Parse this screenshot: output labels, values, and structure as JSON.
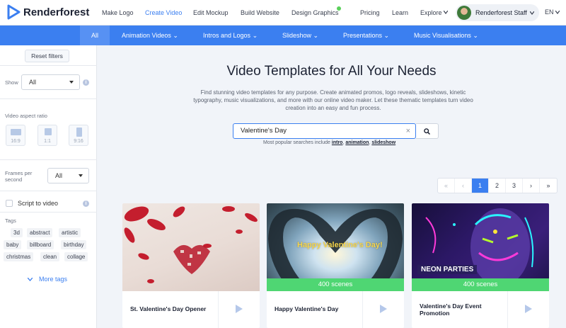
{
  "brand": {
    "name": "Renderforest",
    "accent": "#3b7ff0"
  },
  "topnav": {
    "items": [
      "Make Logo",
      "Create Video",
      "Edit Mockup",
      "Build Website",
      "Design Graphics",
      "Pricing",
      "Learn",
      "Explore"
    ],
    "active": "Create Video",
    "user": "Renderforest Staff",
    "lang": "EN"
  },
  "categories": [
    "All",
    "Animation Videos",
    "Intros and Logos",
    "Slideshow",
    "Presentations",
    "Music Visualisations"
  ],
  "sidebar": {
    "reset": "Reset filters",
    "show_label": "Show",
    "show_value": "All",
    "aspect_label": "Video aspect ratio",
    "ratios": [
      "16:9",
      "1:1",
      "9:16"
    ],
    "fps_label_line1": "Frames per",
    "fps_label_line2": "second",
    "fps_value": "All",
    "script_label": "Script to video",
    "tags_label": "Tags",
    "tags": [
      "3d",
      "abstract",
      "artistic",
      "baby",
      "billboard",
      "birthday",
      "christmas",
      "clean",
      "collage"
    ],
    "more_tags": "More tags"
  },
  "main": {
    "title": "Video Templates for All Your Needs",
    "description": "Find stunning video templates for any purpose. Create animated promos, logo reveals, slideshows, kinetic typography, music visualizations, and more with our online video maker. Let these thematic templates turn video creation into an easy and fun process.",
    "search_value": "Valentine's Day",
    "popular_prefix": "Most popular searches include",
    "popular": [
      "intro",
      "animation",
      "slideshow"
    ]
  },
  "pagination": {
    "items": [
      "«",
      "‹",
      "1",
      "2",
      "3",
      "›",
      "»"
    ],
    "current": "1"
  },
  "cards": [
    {
      "title": "St. Valentine's Day Opener",
      "scenes": ""
    },
    {
      "title": "Happy Valentine's Day",
      "scenes": "400 scenes",
      "overlay": "Happy Valentine's Day!"
    },
    {
      "title_line1": "Valentine's Day Event",
      "title_line2": "Promotion",
      "scenes": "400 scenes",
      "overlay": "NEON PARTIES"
    }
  ]
}
